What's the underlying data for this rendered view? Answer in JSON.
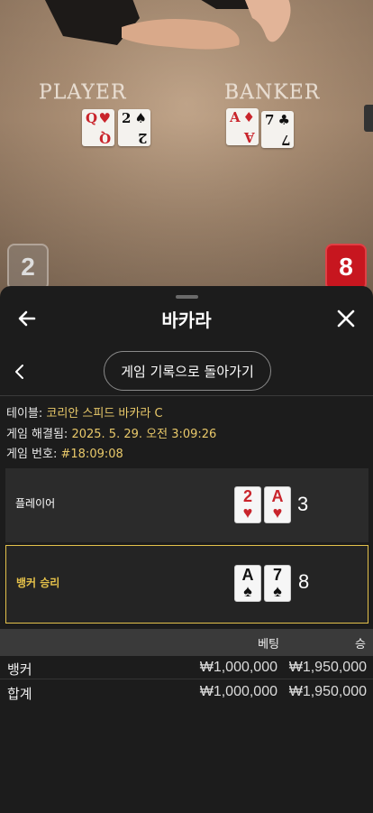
{
  "video": {
    "table_player_text": "PLAYER",
    "table_banker_text": "BANKER",
    "player_cards_on_table": [
      {
        "rank": "Q",
        "suit": "♥",
        "color": "red"
      },
      {
        "rank": "2",
        "suit": "♠",
        "color": "black"
      }
    ],
    "banker_cards_on_table": [
      {
        "rank": "A",
        "suit": "♦",
        "color": "red"
      },
      {
        "rank": "7",
        "suit": "♣",
        "color": "black"
      }
    ],
    "player_score": "2",
    "banker_score": "8"
  },
  "header": {
    "title": "바카라"
  },
  "history_button": {
    "label": "게임 기록으로 돌아가기"
  },
  "info": {
    "table_label": "테이블: ",
    "table_value": "코리안 스피드 바카라 C",
    "resolved_label": "게임 해결됨: ",
    "resolved_value": "2025. 5. 29. 오전 3:09:26",
    "game_no_label": "게임 번호: ",
    "game_no_value": "#18:09:08"
  },
  "results": {
    "player": {
      "label": "플레이어",
      "cards": [
        {
          "rank": "2",
          "suit": "♥",
          "color": "red"
        },
        {
          "rank": "A",
          "suit": "♥",
          "color": "red"
        }
      ],
      "total": "3"
    },
    "banker": {
      "label": "뱅커 승리",
      "cards": [
        {
          "rank": "A",
          "suit": "♠",
          "color": "black"
        },
        {
          "rank": "7",
          "suit": "♠",
          "color": "black"
        }
      ],
      "total": "8"
    }
  },
  "bets": {
    "col_bet": "베팅",
    "col_win": "승",
    "rows": [
      {
        "name": "뱅커",
        "bet": "₩1,000,000",
        "win": "₩1,950,000"
      },
      {
        "name": "합계",
        "bet": "₩1,000,000",
        "win": "₩1,950,000"
      }
    ]
  },
  "colors": {
    "accent_gold": "#e3c14b",
    "banker_red": "#c7161f",
    "sheet_bg": "#1c1c1c"
  },
  "icons": [
    "arrow-left-icon",
    "close-icon",
    "chevron-left-icon"
  ]
}
